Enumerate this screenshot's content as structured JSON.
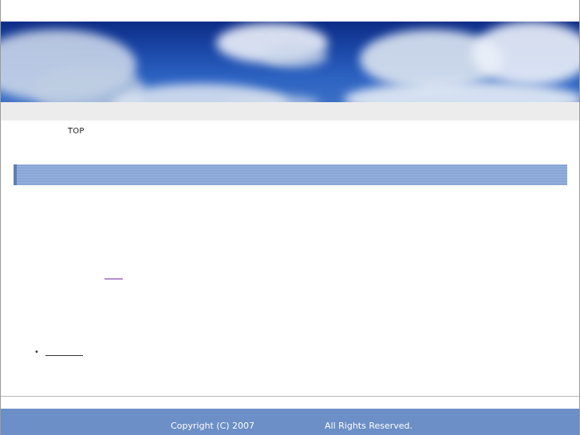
{
  "nav": {
    "top_label": "TOP"
  },
  "footer": {
    "copyright": "Copyright (C) 2007",
    "rights": "All Rights Reserved."
  },
  "colors": {
    "heading_bar": "#8aa8d6",
    "footer_bg": "#6b8fc6",
    "visited_link": "#7a2aa8"
  }
}
